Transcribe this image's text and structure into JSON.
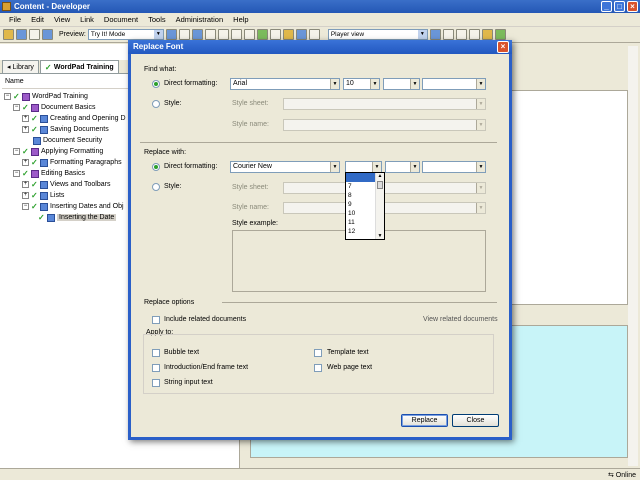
{
  "window": {
    "title": "Content - Developer"
  },
  "menu": [
    "File",
    "Edit",
    "View",
    "Link",
    "Document",
    "Tools",
    "Administration",
    "Help"
  ],
  "toolbar": {
    "preview_label": "Preview:",
    "mode_value": "Try It! Mode",
    "player_value": "Player view"
  },
  "left_tabs": [
    {
      "label": "Library"
    },
    {
      "label": "WordPad Training"
    }
  ],
  "tree_header": "Name",
  "tree": [
    {
      "label": "WordPad Training"
    },
    {
      "label": "Document Basics"
    },
    {
      "label": "Creating and Opening D"
    },
    {
      "label": "Saving Documents"
    },
    {
      "label": "Document Security"
    },
    {
      "label": "Applying Formatting"
    },
    {
      "label": "Formatting Paragraphs"
    },
    {
      "label": "Editing Basics"
    },
    {
      "label": "Views and Toolbars"
    },
    {
      "label": "Lists"
    },
    {
      "label": "Inserting Dates and Obj"
    },
    {
      "label": "Inserting the Date"
    }
  ],
  "status": {
    "online": "Online"
  },
  "dialog": {
    "title": "Replace Font",
    "close": "×",
    "find_what": {
      "heading": "Find what:",
      "direct_label": "Direct formatting:",
      "font": "Arial",
      "size": "10",
      "style_label": "Style:",
      "style_sheet_label": "Style sheet:",
      "style_name_label": "Style name:"
    },
    "replace_with": {
      "heading": "Replace with:",
      "direct_label": "Direct formatting:",
      "font": "Courier New",
      "size": "",
      "style_label": "Style:",
      "style_sheet_label": "Style sheet:",
      "style_name_label": "Style name:",
      "style_example_label": "Style example:"
    },
    "size_options": [
      "",
      "7",
      "8",
      "9",
      "10",
      "11",
      "12"
    ],
    "replace_options": {
      "heading": "Replace options",
      "include_related": "Include related documents",
      "view_related": "View related documents",
      "apply_to": "Apply to:",
      "left": [
        "Bubble text",
        "Introduction/End frame text",
        "String input text"
      ],
      "right": [
        "Template text",
        "Web page text"
      ]
    },
    "buttons": {
      "replace": "Replace",
      "close": "Close"
    }
  }
}
